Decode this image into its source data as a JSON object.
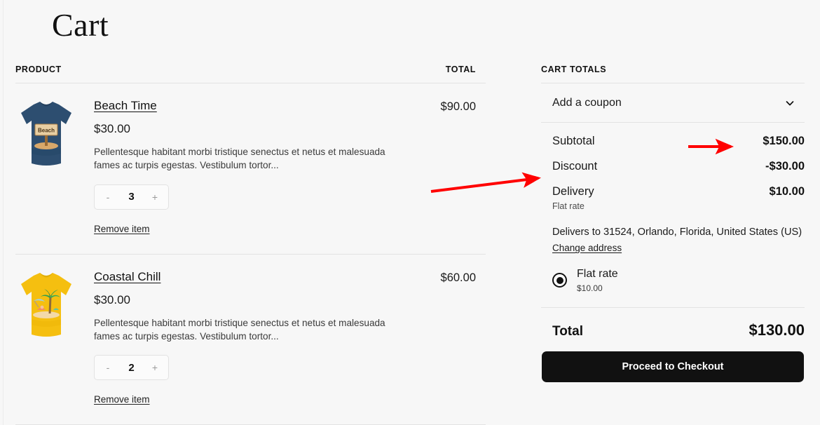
{
  "page": {
    "title": "Cart",
    "background_color": "#f7f7f7",
    "accent_color": "#111111",
    "annotation_color": "#ff0000"
  },
  "products_table": {
    "header_product": "PRODUCT",
    "header_total": "TOTAL",
    "items": [
      {
        "name": "Beach Time",
        "unit_price": "$30.00",
        "description": "Pellentesque habitant morbi tristique senectus et netus et malesuada fames ac turpis egestas. Vestibulum tortor...",
        "quantity": "3",
        "decrease_label": "-",
        "increase_label": "+",
        "remove_label": "Remove item",
        "line_total": "$90.00",
        "thumb": {
          "shirt_color": "#2d4e70",
          "graphic": "beach-sign"
        }
      },
      {
        "name": "Coastal Chill",
        "unit_price": "$30.00",
        "description": "Pellentesque habitant morbi tristique senectus et netus et malesuada fames ac turpis egestas. Vestibulum tortor...",
        "quantity": "2",
        "decrease_label": "-",
        "increase_label": "+",
        "remove_label": "Remove item",
        "line_total": "$60.00",
        "thumb": {
          "shirt_color": "#f5bf10",
          "graphic": "palm-beach-scene"
        }
      }
    ]
  },
  "cart_totals": {
    "heading": "CART TOTALS",
    "coupon_label": "Add a coupon",
    "coupon_icon": "chevron-down-icon",
    "subtotal_label": "Subtotal",
    "subtotal_value": "$150.00",
    "discount_label": "Discount",
    "discount_value": "-$30.00",
    "delivery_label": "Delivery",
    "delivery_value": "$10.00",
    "delivery_note": "Flat rate",
    "address_text": "Delivers to 31524, Orlando, Florida, United States (US)",
    "change_address_label": "Change address",
    "shipping_option_name": "Flat rate",
    "shipping_option_price": "$10.00",
    "shipping_option_selected": true,
    "total_label": "Total",
    "total_value": "$130.00",
    "checkout_label": "Proceed to Checkout"
  }
}
